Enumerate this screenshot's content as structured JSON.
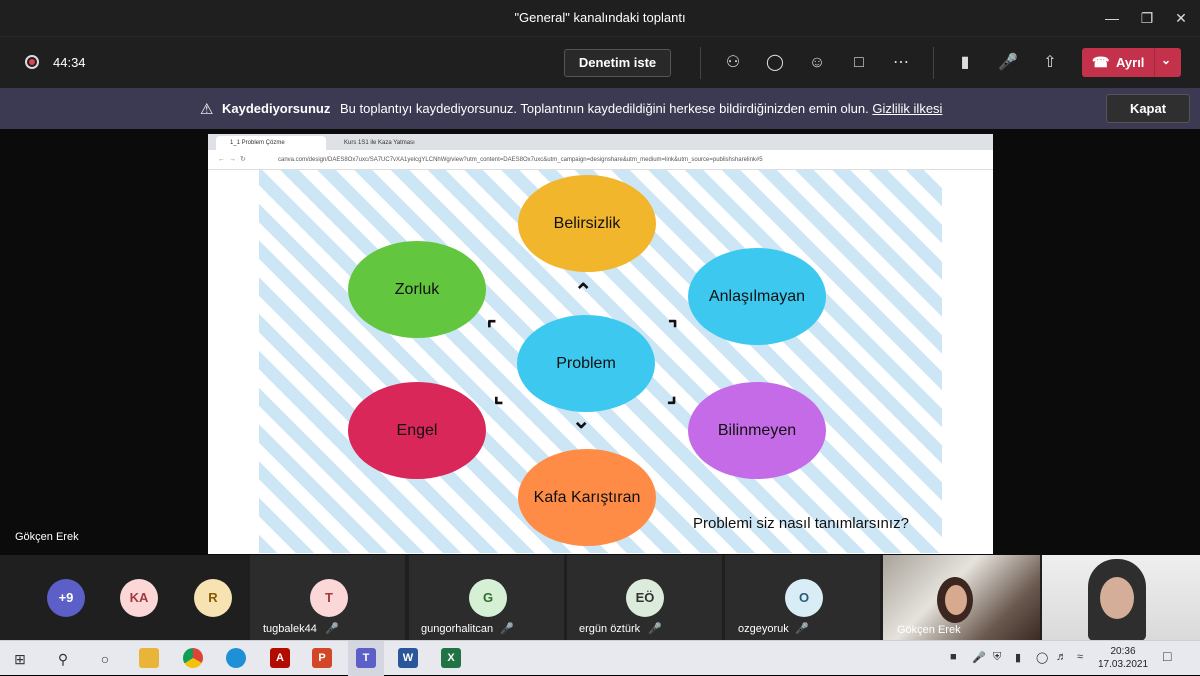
{
  "window": {
    "title": "\"General\" kanalındaki toplantı",
    "minimize_icon": "minimize-icon",
    "restore_icon": "restore-icon",
    "close_icon": "close-icon"
  },
  "toolbar": {
    "timer": "44:34",
    "request_control_label": "Denetim iste",
    "leave_label": "Ayrıl",
    "icons": [
      "participants-icon",
      "chat-icon",
      "reactions-icon",
      "share-tray-icon",
      "more-icon",
      "camera-icon",
      "mic-off-icon",
      "share-icon"
    ]
  },
  "banner": {
    "title": "Kaydediyorsunuz",
    "message": "Bu toplantıyı kaydediyorsunuz. Toplantının kaydedildiğini herkese bildirdiğinizden emin olun.",
    "privacy_link": "Gizlilik ilkesi",
    "close_label": "Kapat"
  },
  "presenter": {
    "name": "Gökçen Erek"
  },
  "browser": {
    "tab_active": "1_1 Problem Çözme",
    "tab_second": "Kurs 1S1 ile Kaza Yatması",
    "url": "canva.com/design/DAES8Ox7uxc/SA7UC7vXA1yelcgYLCNhWg/view?utm_content=DAES8Ox7uxc&utm_campaign=designshare&utm_medium=link&utm_source=publishsharelink#5"
  },
  "slide": {
    "center": "Problem",
    "top": "Belirsizlik",
    "top_left": "Zorluk",
    "top_right": "Anlaşılmayan",
    "bottom_left": "Engel",
    "bottom_right": "Bilinmeyen",
    "bottom": "Kafa Karıştıran",
    "question": "Problemi siz nasıl tanımlarsınız?",
    "colors": {
      "center": "#3dc9ef",
      "top": "#f1b62c",
      "top_left": "#62c73f",
      "top_right": "#3dc9ef",
      "bottom_left": "#d9275a",
      "bottom_right": "#c56be8",
      "bottom": "#ff8c46"
    }
  },
  "participants": {
    "overflow": "+9",
    "avatars": [
      {
        "initials": "KA",
        "name": ""
      },
      {
        "initials": "R",
        "name": ""
      },
      {
        "initials": "T",
        "name": "tugbalek44"
      },
      {
        "initials": "G",
        "name": "gungorhalitcan"
      },
      {
        "initials": "EÖ",
        "name": "ergün öztürk"
      },
      {
        "initials": "O",
        "name": "ozgeyoruk"
      }
    ],
    "video_name": "Gökçen Erek"
  },
  "taskbar": {
    "time": "20:36",
    "date": "17.03.2021",
    "apps": [
      "windows-start-icon",
      "search-icon",
      "task-view-icon",
      "file-explorer-icon",
      "chrome-icon",
      "edge-icon",
      "acrobat-icon",
      "powerpoint-icon",
      "teams-icon",
      "word-icon",
      "excel-icon"
    ]
  }
}
